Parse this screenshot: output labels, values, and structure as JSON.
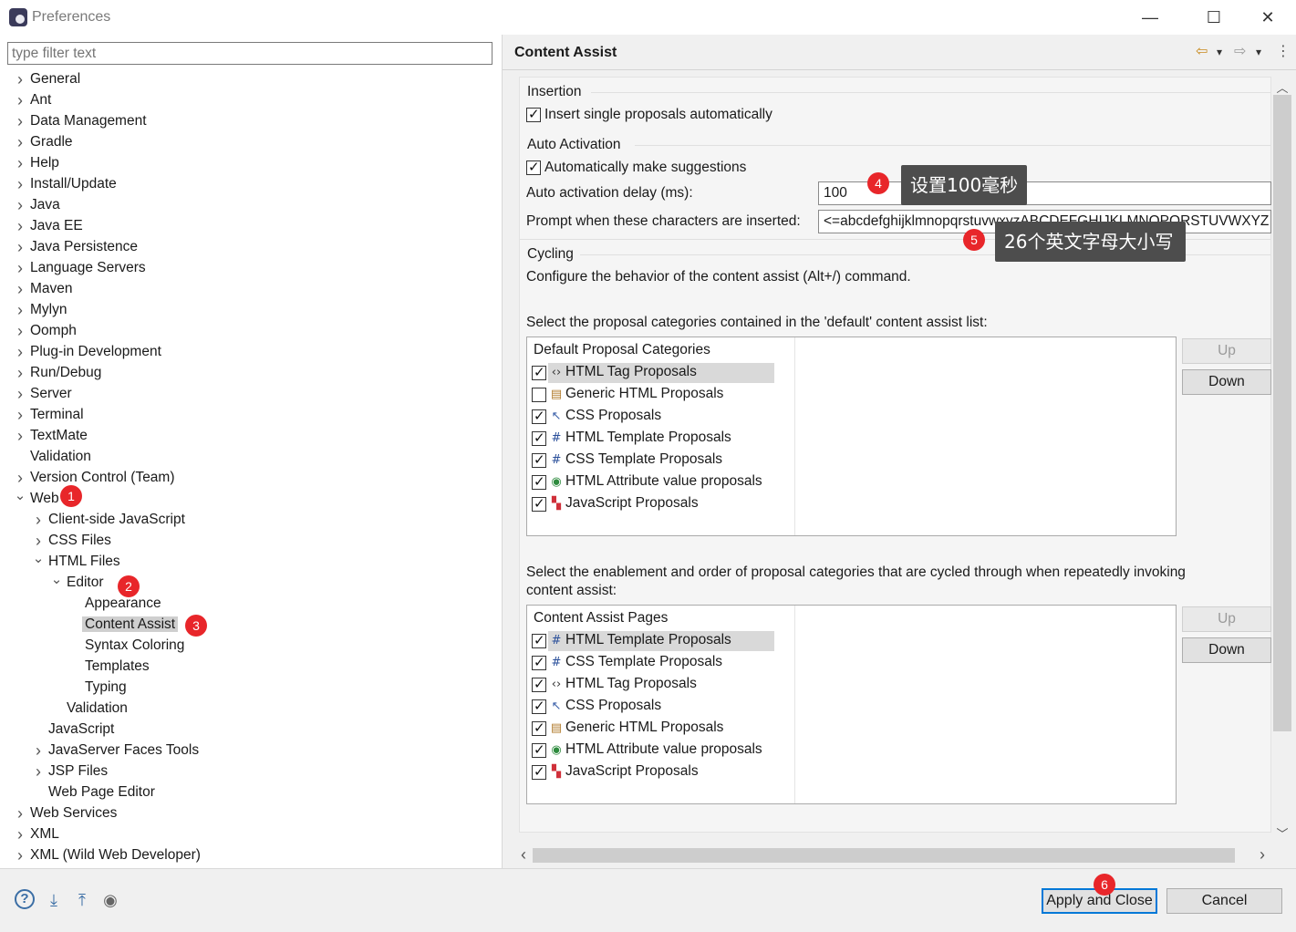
{
  "window": {
    "title": "Preferences",
    "minimize": "—",
    "maximize": "☐",
    "close": "✕"
  },
  "filter": {
    "placeholder": "type filter text"
  },
  "tree": {
    "items": [
      {
        "label": "General",
        "expander": "›"
      },
      {
        "label": "Ant",
        "expander": "›"
      },
      {
        "label": "Data Management",
        "expander": "›"
      },
      {
        "label": "Gradle",
        "expander": "›"
      },
      {
        "label": "Help",
        "expander": "›"
      },
      {
        "label": "Install/Update",
        "expander": "›"
      },
      {
        "label": "Java",
        "expander": "›"
      },
      {
        "label": "Java EE",
        "expander": "›"
      },
      {
        "label": "Java Persistence",
        "expander": "›"
      },
      {
        "label": "Language Servers",
        "expander": "›"
      },
      {
        "label": "Maven",
        "expander": "›"
      },
      {
        "label": "Mylyn",
        "expander": "›"
      },
      {
        "label": "Oomph",
        "expander": "›"
      },
      {
        "label": "Plug-in Development",
        "expander": "›"
      },
      {
        "label": "Run/Debug",
        "expander": "›"
      },
      {
        "label": "Server",
        "expander": "›"
      },
      {
        "label": "Terminal",
        "expander": "›"
      },
      {
        "label": "TextMate",
        "expander": "›"
      },
      {
        "label": "Validation",
        "expander": ""
      },
      {
        "label": "Version Control (Team)",
        "expander": "›"
      },
      {
        "label": "Web",
        "expander": "⌄"
      },
      {
        "label": "Client-side JavaScript",
        "expander": "›"
      },
      {
        "label": "CSS Files",
        "expander": "›"
      },
      {
        "label": "HTML Files",
        "expander": "⌄"
      },
      {
        "label": "Editor",
        "expander": "⌄"
      },
      {
        "label": "Appearance",
        "expander": ""
      },
      {
        "label": "Content Assist",
        "expander": "",
        "selected": true
      },
      {
        "label": "Syntax Coloring",
        "expander": ""
      },
      {
        "label": "Templates",
        "expander": ""
      },
      {
        "label": "Typing",
        "expander": ""
      },
      {
        "label": "Validation",
        "expander": ""
      },
      {
        "label": "JavaScript",
        "expander": ""
      },
      {
        "label": "JavaServer Faces Tools",
        "expander": "›"
      },
      {
        "label": "JSP Files",
        "expander": "›"
      },
      {
        "label": "Web Page Editor",
        "expander": ""
      },
      {
        "label": "Web Services",
        "expander": "›"
      },
      {
        "label": "XML",
        "expander": "›"
      },
      {
        "label": "XML (Wild Web Developer)",
        "expander": "›"
      }
    ]
  },
  "page": {
    "title": "Content Assist",
    "nav": {
      "back": "⇦",
      "back_menu": "▾",
      "forward": "⇨",
      "forward_menu": "▾",
      "more": "⋮"
    }
  },
  "insertion": {
    "title": "Insertion",
    "insert_single": {
      "label": "Insert single proposals automatically",
      "checked": true
    }
  },
  "auto_activation": {
    "title": "Auto Activation",
    "make_suggestions": {
      "label": "Automatically make suggestions",
      "checked": true
    },
    "delay_label": "Auto activation delay (ms):",
    "delay_value": "100",
    "prompt_label": "Prompt when these characters are inserted:",
    "prompt_value": "<=abcdefghijklmnopqrstuvwxyzABCDEFGHIJKLMNOPQRSTUVWXYZ"
  },
  "cycling": {
    "title": "Cycling",
    "description": "Configure the behavior of the content assist (Alt+/) command."
  },
  "default_list": {
    "caption": "Select the proposal categories contained in the 'default' content assist list:",
    "header": "Default Proposal Categories",
    "rows": [
      {
        "label": "HTML Tag Proposals",
        "checked": true,
        "icon": "‹›",
        "icon_name": "html-tag-icon",
        "icon_color": "#333333"
      },
      {
        "label": "Generic HTML Proposals",
        "checked": false,
        "icon": "▤",
        "icon_name": "generic-html-icon",
        "icon_color": "#b07a2a"
      },
      {
        "label": "CSS Proposals",
        "checked": true,
        "icon": "↖",
        "icon_name": "css-icon",
        "icon_color": "#3a5fa8"
      },
      {
        "label": "HTML Template Proposals",
        "checked": true,
        "icon": "#",
        "icon_name": "template-icon",
        "icon_color": "#2a4f9a"
      },
      {
        "label": "CSS Template Proposals",
        "checked": true,
        "icon": "#",
        "icon_name": "template-icon",
        "icon_color": "#2a4f9a"
      },
      {
        "label": "HTML Attribute value proposals",
        "checked": true,
        "icon": "◉",
        "icon_name": "attribute-icon",
        "icon_color": "#2e8b3e"
      },
      {
        "label": "JavaScript Proposals",
        "checked": true,
        "icon": "▚",
        "icon_name": "javascript-icon",
        "icon_color": "#d0303a"
      }
    ],
    "up": "Up",
    "down": "Down"
  },
  "cycle_list": {
    "caption_line1": "Select the enablement and order of proposal categories that are cycled through when repeatedly invoking",
    "caption_line2": "content assist:",
    "header": "Content Assist Pages",
    "rows": [
      {
        "label": "HTML Template Proposals",
        "checked": true,
        "icon": "#",
        "icon_name": "template-icon",
        "icon_color": "#2a4f9a"
      },
      {
        "label": "CSS Template Proposals",
        "checked": true,
        "icon": "#",
        "icon_name": "template-icon",
        "icon_color": "#2a4f9a"
      },
      {
        "label": "HTML Tag Proposals",
        "checked": true,
        "icon": "‹›",
        "icon_name": "html-tag-icon",
        "icon_color": "#333333"
      },
      {
        "label": "CSS Proposals",
        "checked": true,
        "icon": "↖",
        "icon_name": "css-icon",
        "icon_color": "#3a5fa8"
      },
      {
        "label": "Generic HTML Proposals",
        "checked": true,
        "icon": "▤",
        "icon_name": "generic-html-icon",
        "icon_color": "#b07a2a"
      },
      {
        "label": "HTML Attribute value proposals",
        "checked": true,
        "icon": "◉",
        "icon_name": "attribute-icon",
        "icon_color": "#2e8b3e"
      },
      {
        "label": "JavaScript Proposals",
        "checked": true,
        "icon": "▚",
        "icon_name": "javascript-icon",
        "icon_color": "#d0303a"
      }
    ],
    "up": "Up",
    "down": "Down"
  },
  "scroll": {
    "up": "︿",
    "down": "﹀",
    "left": "‹",
    "right": "›"
  },
  "bottom": {
    "help": "?",
    "import": "⤓",
    "export": "⤒",
    "record": "◉",
    "apply_close": "Apply and Close",
    "cancel": "Cancel"
  },
  "annotations": {
    "badges": [
      "1",
      "2",
      "3",
      "4",
      "5",
      "6"
    ],
    "callout_delay": "设置100毫秒",
    "callout_chars": "26个英文字母大小写"
  },
  "colors": {
    "accent": "#0078d7",
    "badge": "#e8262a",
    "callout": "#4d4d4d"
  }
}
